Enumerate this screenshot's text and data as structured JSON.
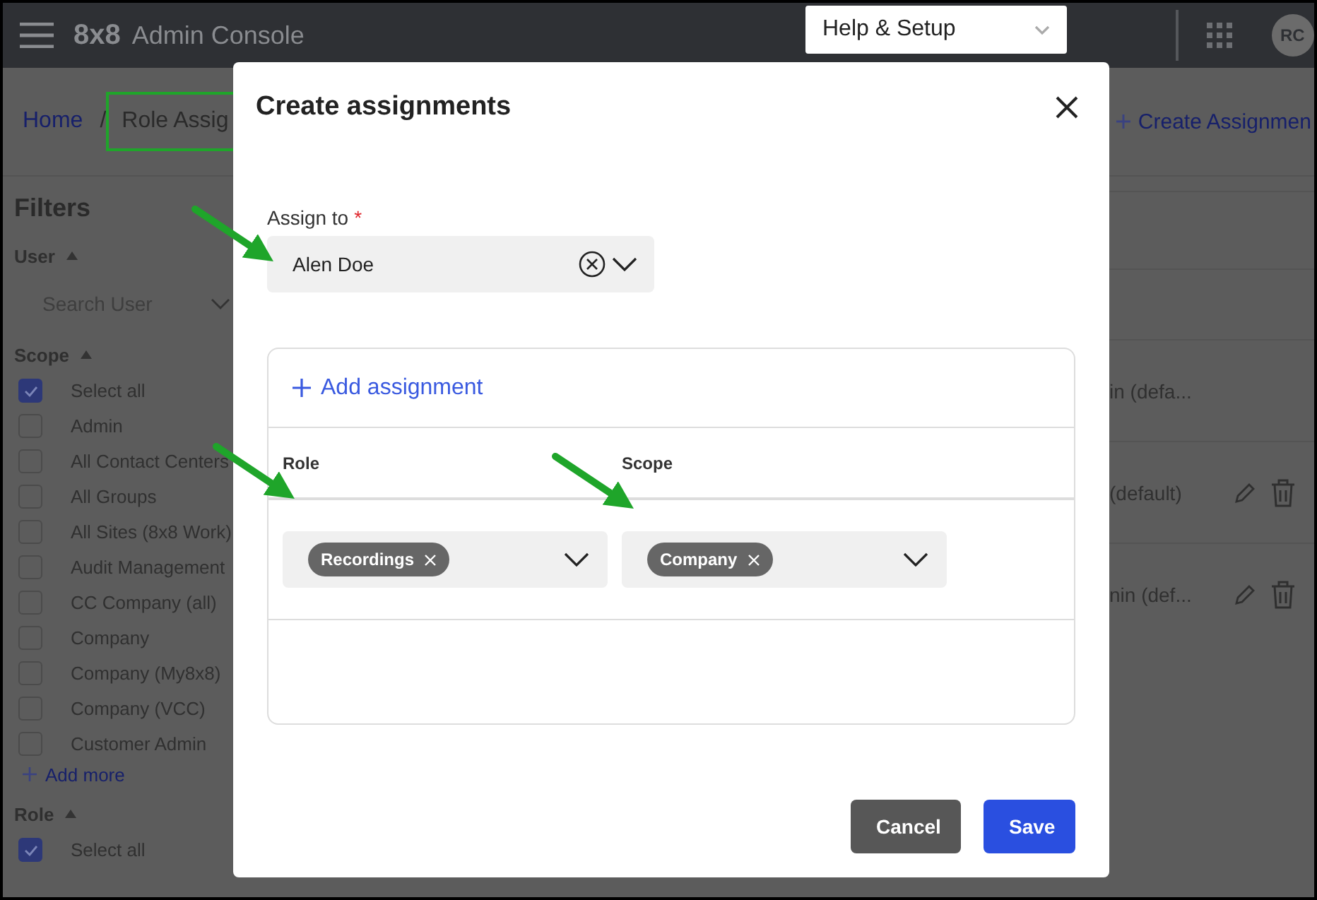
{
  "topbar": {
    "logo": "8x8",
    "title": "Admin Console",
    "help_menu": "Help & Setup",
    "avatar": "RC"
  },
  "breadcrumb": {
    "separator": "/",
    "items": [
      {
        "label": "Home",
        "link": true,
        "highlighted": false
      },
      {
        "label": "Role Assig",
        "link": false,
        "highlighted": true
      }
    ]
  },
  "create_action": "Create Assignmen",
  "filters": {
    "title": "Filters",
    "sections": [
      {
        "title": "User",
        "expanded": true,
        "kind": "search",
        "placeholder": "Search User"
      },
      {
        "title": "Scope",
        "expanded": true,
        "kind": "checklist",
        "add_more": "Add more",
        "options": [
          {
            "label": "Select all",
            "checked": true
          },
          {
            "label": "Admin",
            "checked": false
          },
          {
            "label": "All Contact Centers",
            "checked": false
          },
          {
            "label": "All Groups",
            "checked": false
          },
          {
            "label": "All Sites (8x8 Work)",
            "checked": false
          },
          {
            "label": "Audit Management",
            "checked": false
          },
          {
            "label": "CC Company (all)",
            "checked": false
          },
          {
            "label": "Company",
            "checked": false
          },
          {
            "label": "Company (My8x8)",
            "checked": false
          },
          {
            "label": "Company (VCC)",
            "checked": false
          },
          {
            "label": "Customer Admin",
            "checked": false
          }
        ]
      },
      {
        "title": "Role",
        "expanded": true,
        "kind": "checklist",
        "options": [
          {
            "label": "Select all",
            "checked": true
          }
        ]
      }
    ]
  },
  "table_rows": [
    {
      "cell": "in (defa..."
    },
    {
      "cell": "(default)",
      "actions": [
        {
          "kind": "edit"
        },
        {
          "kind": "delete"
        }
      ]
    },
    {
      "cell": "nin (def...",
      "actions": [
        {
          "kind": "edit"
        },
        {
          "kind": "delete"
        }
      ]
    }
  ],
  "modal": {
    "title": "Create assignments",
    "assign_to": {
      "label": "Assign to",
      "required_mark": "*",
      "value": "Alen Doe"
    },
    "add_assignment": "Add assignment",
    "columns": [
      "Role",
      "Scope"
    ],
    "assignments": [
      {
        "role": "Recordings",
        "scope": "Company"
      }
    ],
    "buttons": [
      {
        "label": "Cancel",
        "kind": "secondary"
      },
      {
        "label": "Save",
        "kind": "primary"
      }
    ]
  }
}
